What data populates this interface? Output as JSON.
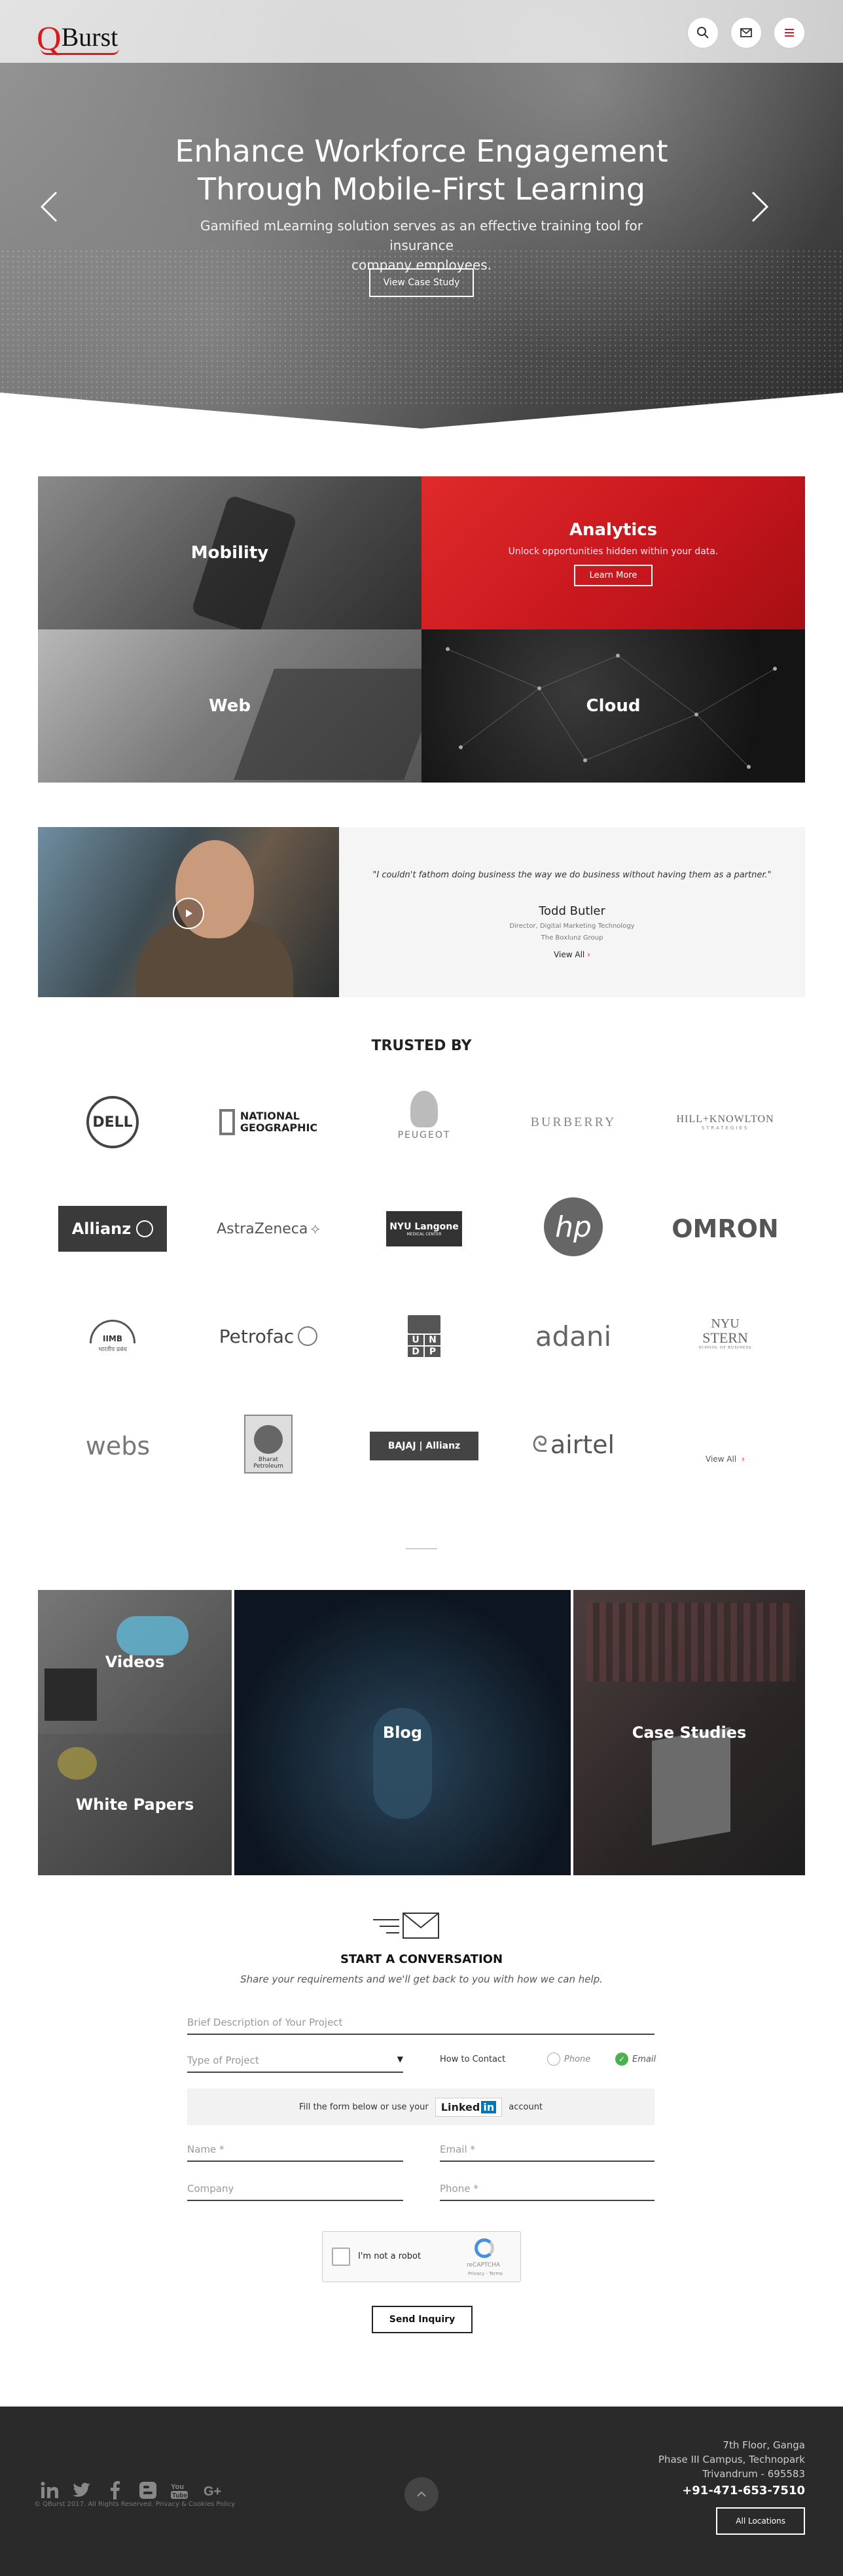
{
  "header": {
    "logo_q": "Q",
    "logo_text": "Burst",
    "icons": [
      "search-icon",
      "mail-icon",
      "menu-icon"
    ]
  },
  "hero": {
    "title_line1": "Enhance Workforce Engagement",
    "title_line2": "Through Mobile-First Learning",
    "subtitle_line1": "Gamified mLearning solution serves as an effective training tool for insurance",
    "subtitle_line2": "company employees.",
    "button": "View Case Study"
  },
  "services": {
    "mobility": "Mobility",
    "analytics": "Analytics",
    "analytics_desc": "Unlock opportunities hidden within your data.",
    "analytics_btn": "Learn More",
    "web": "Web",
    "cloud": "Cloud"
  },
  "testimonial": {
    "quote": "\"I couldn't fathom doing business the way we do business without having them as a partner.\"",
    "name": "Todd Butler",
    "role": "Director, Digital Marketing Technology",
    "company": "The Boxlunz Group",
    "view_all": "View All"
  },
  "trusted": {
    "heading": "TRUSTED BY",
    "logos": {
      "dell": "DELL",
      "natgeo1": "NATIONAL",
      "natgeo2": "GEOGRAPHIC",
      "peugeot": "PEUGEOT",
      "burberry": "BURBERRY",
      "hillknowlton": "HILL+KNOWLTON",
      "hillknowlton_sub": "STRATEGIES",
      "allianz": "Allianz",
      "astrazeneca": "AstraZeneca",
      "nyu_langone": "NYU Langone",
      "nyu_langone_sub": "MEDICAL CENTER",
      "hp": "hp",
      "omron": "OMRON",
      "iimb": "IIMB",
      "iimb_sub": "भारतीय प्रबंध",
      "petrofac": "Petrofac",
      "undp": [
        "U",
        "N",
        "D",
        "P"
      ],
      "adani": "adani",
      "nyu_stern1": "NYU",
      "nyu_stern2": "STERN",
      "nyu_stern_sub": "SCHOOL OF BUSINESS",
      "webs": "webs",
      "bharat1": "Bharat",
      "bharat2": "Petroleum",
      "bajaj": "BAJAJ | Allianz",
      "airtel": "airtel"
    },
    "view_all": "View All"
  },
  "resources": {
    "videos": "Videos",
    "white_papers": "White Papers",
    "blog": "Blog",
    "case_studies": "Case Studies"
  },
  "contact": {
    "heading": "START A CONVERSATION",
    "subheading": "Share your requirements and we'll get back to you with how we can help.",
    "description_placeholder": "Brief Description of Your Project",
    "project_type_placeholder": "Type of Project",
    "how_to_contact": "How to Contact",
    "phone_option": "Phone",
    "email_option": "Email",
    "linkedin_prefix": "Fill the form below or use your",
    "linkedin_word": "Linked",
    "linkedin_in": "in",
    "linkedin_suffix": "account",
    "name_placeholder": "Name *",
    "email_placeholder": "Email *",
    "company_placeholder": "Company",
    "phone_placeholder": "Phone *",
    "captcha_label": "I'm not a robot",
    "captcha_brand": "reCAPTCHA",
    "captcha_links": "Privacy - Terms",
    "send_button": "Send Inquiry"
  },
  "footer": {
    "addr1": "7th Floor, Ganga",
    "addr2": "Phase III Campus, Technopark",
    "addr3": "Trivandrum - 695583",
    "phone": "+91-471-653-7510",
    "locations_btn": "All Locations",
    "copyright": "© QBurst 2017. All Rights Reserved.",
    "privacy": "Privacy & Cookies Policy",
    "social": [
      "linkedin-icon",
      "twitter-icon",
      "facebook-icon",
      "blogger-icon",
      "youtube-icon",
      "google-plus-icon"
    ]
  },
  "colors": {
    "brand_red": "#d71920",
    "footer_bg": "#2a2a2a",
    "email_selected": "#4caf50"
  }
}
